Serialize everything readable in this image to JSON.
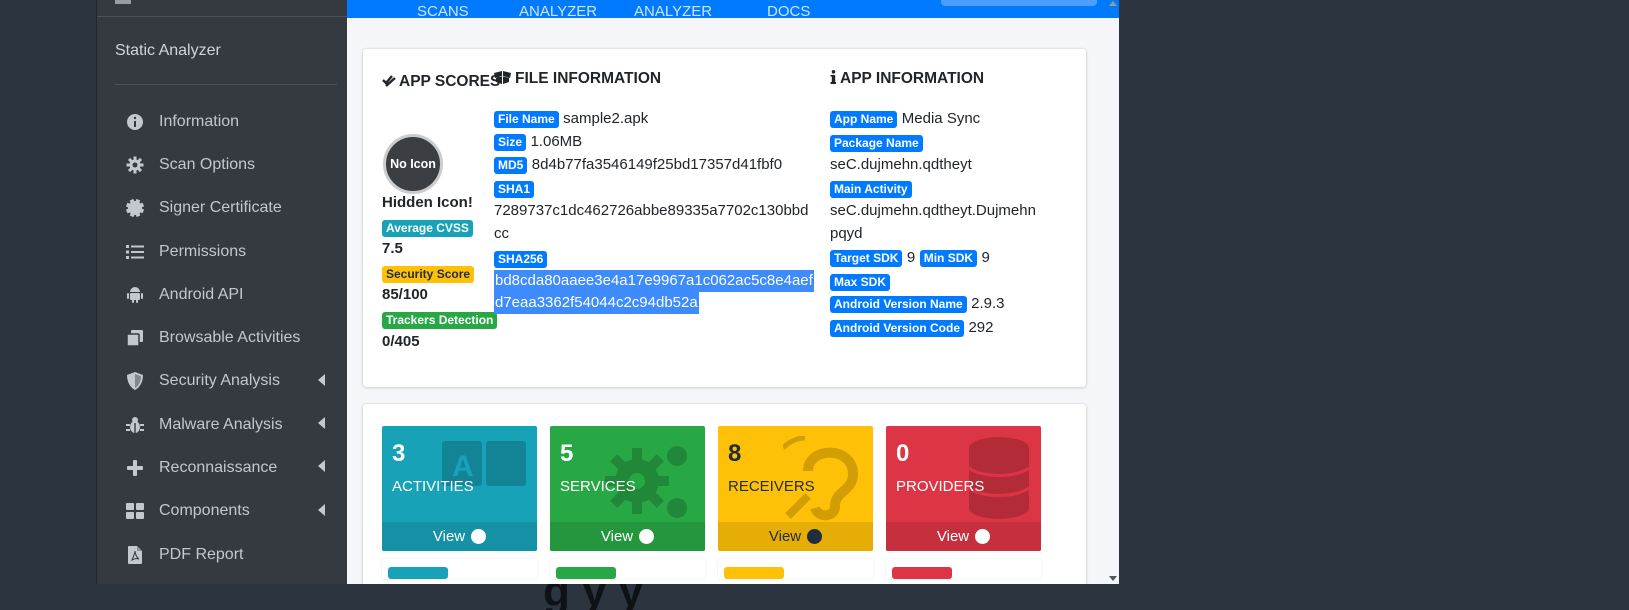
{
  "sidebar": {
    "title": "Static Analyzer",
    "items": [
      {
        "label": "Information",
        "icon": "info-circle-icon",
        "expandable": false
      },
      {
        "label": "Scan Options",
        "icon": "gear-icon",
        "expandable": false
      },
      {
        "label": "Signer Certificate",
        "icon": "certificate-icon",
        "expandable": false
      },
      {
        "label": "Permissions",
        "icon": "list-icon",
        "expandable": false
      },
      {
        "label": "Android API",
        "icon": "android-icon",
        "expandable": false
      },
      {
        "label": "Browsable Activities",
        "icon": "clone-icon",
        "expandable": false
      },
      {
        "label": "Security Analysis",
        "icon": "shield-icon",
        "expandable": true
      },
      {
        "label": "Malware Analysis",
        "icon": "bug-icon",
        "expandable": true
      },
      {
        "label": "Reconnaissance",
        "icon": "plus-icon",
        "expandable": true
      },
      {
        "label": "Components",
        "icon": "grid-icon",
        "expandable": true
      },
      {
        "label": "PDF Report",
        "icon": "file-pdf-icon",
        "expandable": false
      }
    ]
  },
  "topbar": {
    "tabs": [
      "SCANS",
      "ANALYZER",
      "ANALYZER",
      "DOCS"
    ]
  },
  "app_scores": {
    "title": "APP SCORES",
    "icon_text": "No Icon",
    "hidden_icon_text": "Hidden Icon!",
    "avg_cvss_label": "Average CVSS",
    "avg_cvss_value": "7.5",
    "security_score_label": "Security Score",
    "security_score_value": "85/100",
    "trackers_label": "Trackers Detection",
    "trackers_value": "0/405"
  },
  "file_info": {
    "title": "FILE INFORMATION",
    "file_name_label": "File Name",
    "file_name": "sample2.apk",
    "size_label": "Size",
    "size": "1.06MB",
    "md5_label": "MD5",
    "md5": "8d4b77fa3546149f25bd17357d41fbf0",
    "sha1_label": "SHA1",
    "sha1_line1": "7289737c1dc462726abbe89335a7702c130bbd",
    "sha1_line2": "cc",
    "sha256_label": "SHA256",
    "sha256_line1": "bd8cda80aaee3e4a17e9967a1c062ac5c8e4aef",
    "sha256_line2": "d7eaa3362f54044c2c94db52a"
  },
  "app_info": {
    "title": "APP INFORMATION",
    "app_name_label": "App Name",
    "app_name": "Media Sync",
    "package_label": "Package Name",
    "package": "seC.dujmehn.qdtheyt",
    "main_activity_label": "Main Activity",
    "main_activity_line1": "seC.dujmehn.qdtheyt.Dujmehn",
    "main_activity_line2": "pqyd",
    "target_sdk_label": "Target SDK",
    "target_sdk": "9",
    "min_sdk_label": "Min SDK",
    "min_sdk": "9",
    "max_sdk_label": "Max SDK",
    "version_name_label": "Android Version Name",
    "version_name": "2.9.3",
    "version_code_label": "Android Version Code",
    "version_code": "292"
  },
  "stats": [
    {
      "count": "3",
      "label": "ACTIVITIES",
      "view": "View",
      "color": "#17a2b8",
      "foot": "#1591a5",
      "icon": "language-icon",
      "text_color": "#ffffff"
    },
    {
      "count": "5",
      "label": "SERVICES",
      "view": "View",
      "color": "#28a745",
      "foot": "#24963e",
      "icon": "cogs-icon",
      "text_color": "#ffffff"
    },
    {
      "count": "8",
      "label": "RECEIVERS",
      "view": "View",
      "color": "#ffc107",
      "foot": "#e5ad06",
      "icon": "assistive-listening-icon",
      "text_color": "#1f2d3d"
    },
    {
      "count": "0",
      "label": "PROVIDERS",
      "view": "View",
      "color": "#dc3545",
      "foot": "#c62f3e",
      "icon": "database-icon",
      "text_color": "#ffffff"
    }
  ],
  "background_heading": "g    y    y"
}
